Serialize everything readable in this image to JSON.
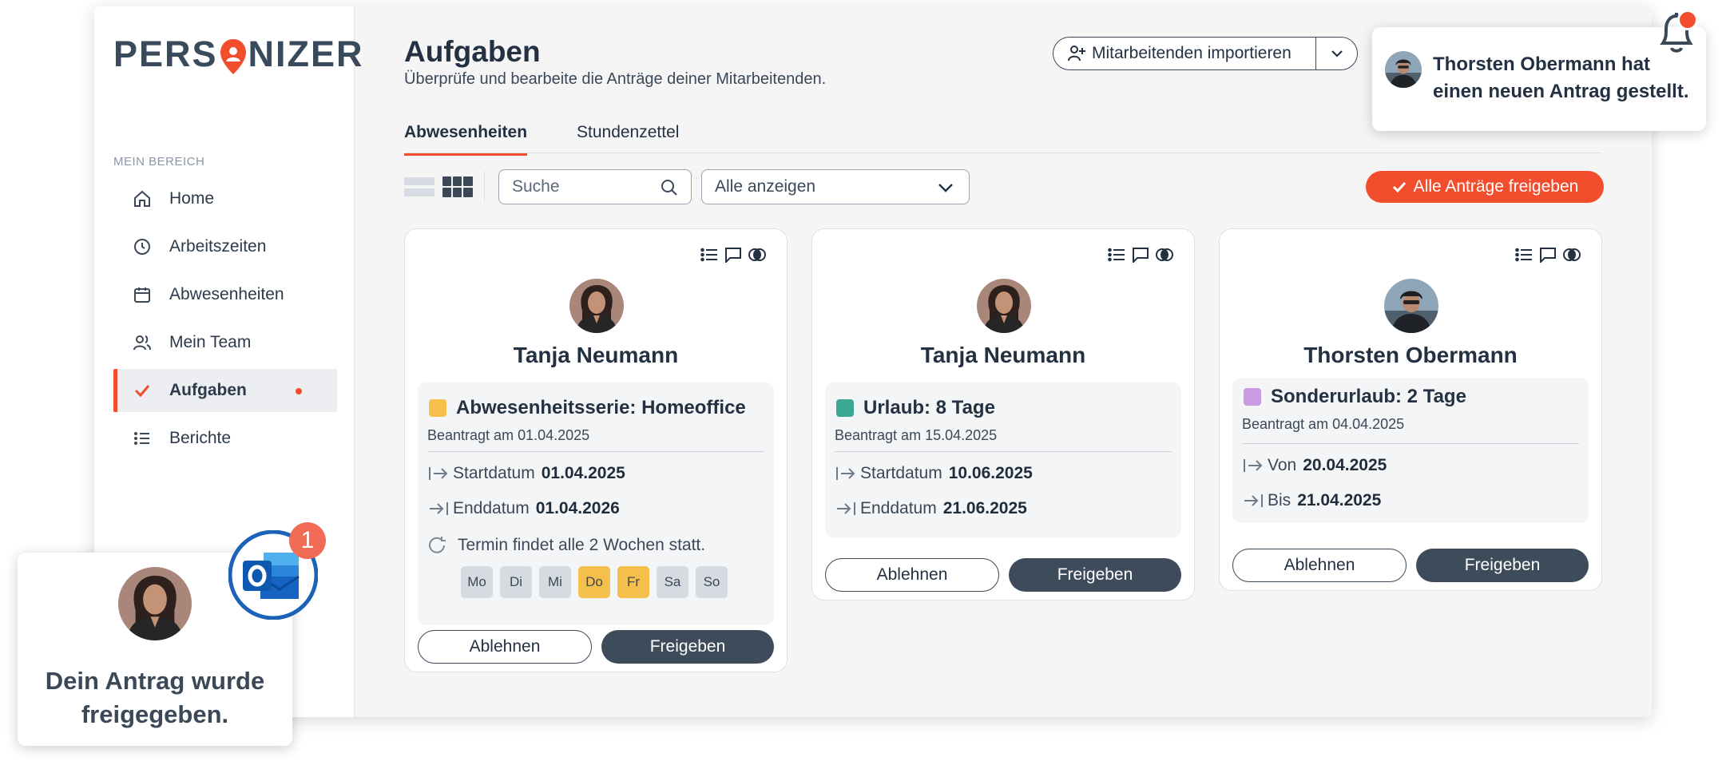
{
  "brand": {
    "logo_text_left": "PERS",
    "logo_text_right": "NIZER",
    "accent_color": "#f24e2e"
  },
  "sidebar": {
    "section_label": "MEIN BEREICH",
    "items": [
      {
        "label": "Home",
        "icon": "home-icon"
      },
      {
        "label": "Arbeitszeiten",
        "icon": "clock-icon"
      },
      {
        "label": "Abwesenheiten",
        "icon": "calendar-icon"
      },
      {
        "label": "Mein Team",
        "icon": "team-icon"
      },
      {
        "label": "Aufgaben",
        "icon": "check-icon",
        "active": true
      },
      {
        "label": "Berichte",
        "icon": "list-icon"
      }
    ]
  },
  "header": {
    "title": "Aufgaben",
    "subtitle": "Überprüfe und bearbeite die Anträge deiner Mitarbeitenden.",
    "import_label": "Mitarbeitenden importieren"
  },
  "tabs": [
    {
      "label": "Abwesenheiten",
      "active": true
    },
    {
      "label": "Stundenzettel",
      "active": false
    }
  ],
  "toolbar": {
    "search_placeholder": "Suche",
    "filter_value": "Alle anzeigen",
    "approve_all_label": "Alle Anträge freigeben"
  },
  "cards": [
    {
      "name": "Tanja Neumann",
      "request_title": "Abwesenheitsserie: Homeoffice",
      "color": "#f5bf4c",
      "requested_on": "Beantragt am 01.04.2025",
      "rows": [
        {
          "label": "Startdatum",
          "value": "01.04.2025"
        },
        {
          "label": "Enddatum",
          "value": "01.04.2026"
        }
      ],
      "repeat_text": "Termin findet alle 2 Wochen statt.",
      "days": [
        {
          "label": "Mo",
          "on": false
        },
        {
          "label": "Di",
          "on": false
        },
        {
          "label": "Mi",
          "on": false
        },
        {
          "label": "Do",
          "on": true
        },
        {
          "label": "Fr",
          "on": true
        },
        {
          "label": "Sa",
          "on": false
        },
        {
          "label": "So",
          "on": false
        }
      ],
      "reject_label": "Ablehnen",
      "approve_label": "Freigeben"
    },
    {
      "name": "Tanja Neumann",
      "request_title": "Urlaub: 8 Tage",
      "color": "#3aa893",
      "requested_on": "Beantragt am 15.04.2025",
      "rows": [
        {
          "label": "Startdatum",
          "value": "10.06.2025"
        },
        {
          "label": "Enddatum",
          "value": "21.06.2025"
        }
      ],
      "reject_label": "Ablehnen",
      "approve_label": "Freigeben"
    },
    {
      "name": "Thorsten Obermann",
      "request_title": "Sonderurlaub: 2 Tage",
      "color": "#c89be3",
      "requested_on": "Beantragt am 04.04.2025",
      "rows": [
        {
          "label": "Von",
          "value": "20.04.2025"
        },
        {
          "label": "Bis",
          "value": "21.04.2025"
        }
      ],
      "reject_label": "Ablehnen",
      "approve_label": "Freigeben"
    }
  ],
  "notification": {
    "text": "Thorsten Obermann hat einen neuen Antrag gestellt."
  },
  "approved_toast": {
    "text": "Dein Antrag wurde freigegeben.",
    "outlook_badge": "1"
  }
}
